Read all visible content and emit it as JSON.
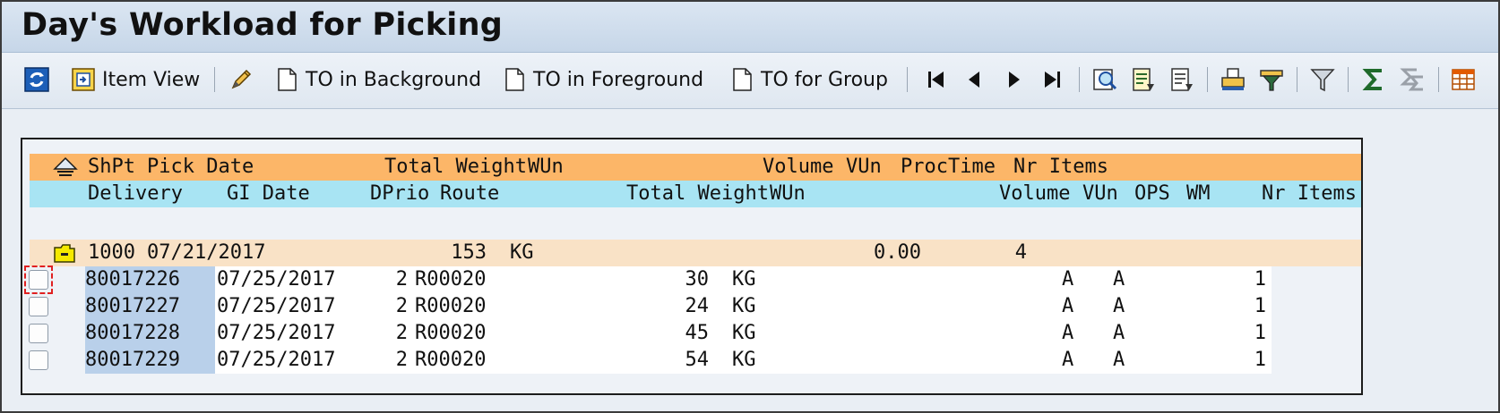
{
  "window": {
    "title": "Day's Workload for Picking"
  },
  "toolbar": {
    "item_view": "Item View",
    "to_background": "TO in Background",
    "to_foreground": "TO in Foreground",
    "to_group": "TO for Group"
  },
  "grid": {
    "header1": {
      "shpt": "ShPt",
      "pick_date": "Pick Date",
      "total_weight": "Total Weight",
      "wun": "WUn",
      "volume": "Volume",
      "vun": "VUn",
      "proctime": "ProcTime",
      "nr_items": "Nr Items"
    },
    "header2": {
      "delivery": "Delivery",
      "gi_date": "GI Date",
      "dprio": "DPrio",
      "route": "Route",
      "total_weight": "Total Weight",
      "wun": "WUn",
      "volume": "Volume",
      "vun": "VUn",
      "ops": "OPS",
      "wm": "WM",
      "nr_items": "Nr Items"
    },
    "summary": {
      "shpt": "1000",
      "pick_date": "07/21/2017",
      "total_weight": "153",
      "wun": "KG",
      "proctime": "0.00",
      "nr_items": "4"
    },
    "rows": [
      {
        "delivery": "80017226",
        "gi_date": "07/25/2017",
        "dprio": "2",
        "route": "R00020",
        "total_weight": "30",
        "wun": "KG",
        "ops": "A",
        "wm": "A",
        "nr_items": "1"
      },
      {
        "delivery": "80017227",
        "gi_date": "07/25/2017",
        "dprio": "2",
        "route": "R00020",
        "total_weight": "24",
        "wun": "KG",
        "ops": "A",
        "wm": "A",
        "nr_items": "1"
      },
      {
        "delivery": "80017228",
        "gi_date": "07/25/2017",
        "dprio": "2",
        "route": "R00020",
        "total_weight": "45",
        "wun": "KG",
        "ops": "A",
        "wm": "A",
        "nr_items": "1"
      },
      {
        "delivery": "80017229",
        "gi_date": "07/25/2017",
        "dprio": "2",
        "route": "R00020",
        "total_weight": "54",
        "wun": "KG",
        "ops": "A",
        "wm": "A",
        "nr_items": "1"
      }
    ]
  },
  "icons": {
    "refresh": "refresh-icon",
    "item_view": "item-view-icon",
    "change": "pencil-icon",
    "document": "document-icon",
    "first": "first-page-icon",
    "previous": "previous-page-icon",
    "next": "next-page-icon",
    "last": "last-page-icon",
    "details": "details-icon",
    "sort_asc": "sort-ascending-icon",
    "sort_desc": "sort-descending-icon",
    "set_filter": "filter-icon",
    "total": "sum-icon",
    "subtotal": "subtotal-icon",
    "layout": "layout-grid-icon",
    "collapse": "collapse-tree-icon",
    "folder": "folder-icon"
  },
  "colors": {
    "header1_bg": "#fcb668",
    "header2_bg": "#a8e4f3",
    "summary_bg": "#f9e2c6",
    "key_bg": "#b9d0ea",
    "focus": "#e02020"
  }
}
